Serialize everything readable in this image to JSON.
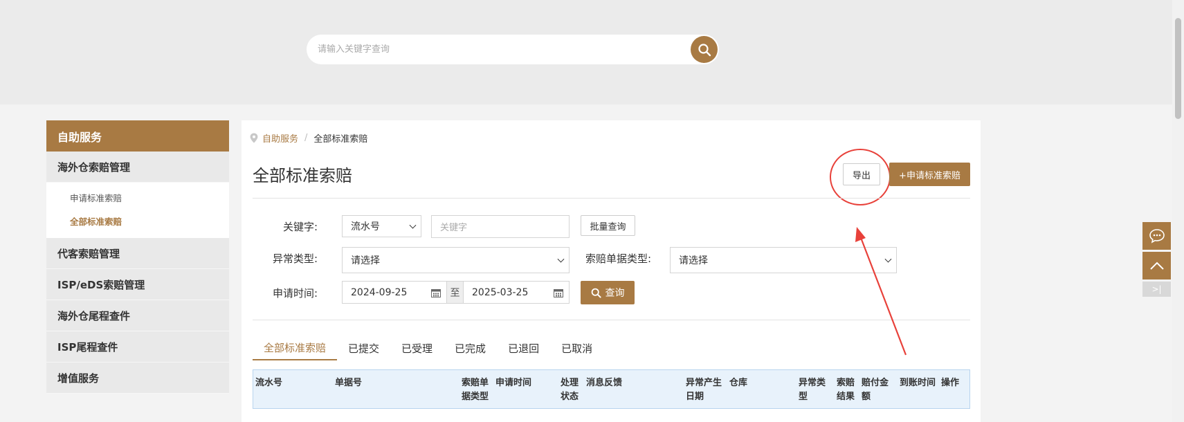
{
  "search": {
    "placeholder": "请输入关键字查询"
  },
  "sidebar": {
    "title": "自助服务",
    "groups": [
      {
        "label": "海外仓索赔管理",
        "items": [
          {
            "label": "申请标准索赔"
          },
          {
            "label": "全部标准索赔",
            "active": true
          }
        ]
      },
      {
        "label": "代客索赔管理"
      },
      {
        "label": "ISP/eDS索赔管理"
      },
      {
        "label": "海外仓尾程查件"
      },
      {
        "label": "ISP尾程查件"
      },
      {
        "label": "增值服务"
      }
    ]
  },
  "breadcrumb": {
    "parent": "自助服务",
    "sep": "/",
    "current": "全部标准索赔"
  },
  "page": {
    "title": "全部标准索赔",
    "export_label": "导出",
    "apply_label": "+申请标准索赔"
  },
  "filters": {
    "keyword_label": "关键字:",
    "keyword_type": "流水号",
    "keyword_placeholder": "关键字",
    "batch_label": "批量查询",
    "abnormal_label": "异常类型:",
    "abnormal_value": "请选择",
    "doc_type_label": "索赔单据类型:",
    "doc_type_value": "请选择",
    "date_label": "申请时间:",
    "date_from": "2024-09-25",
    "date_to": "2025-03-25",
    "to_label": "至",
    "query_label": "查询"
  },
  "tabs": [
    {
      "label": "全部标准索赔",
      "active": true
    },
    {
      "label": "已提交"
    },
    {
      "label": "已受理"
    },
    {
      "label": "已完成"
    },
    {
      "label": "已退回"
    },
    {
      "label": "已取消"
    }
  ],
  "table": {
    "headers": [
      "流水号",
      "单据号",
      "索赔单据类型",
      "申请时间",
      "处理状态",
      "消息反馈",
      "异常产生日期",
      "仓库",
      "异常类型",
      "索赔结果",
      "赔付金额",
      "到账时间",
      "操作"
    ]
  },
  "floating": {
    "collapse_label": ">|"
  },
  "colors": {
    "accent": "#a87a43",
    "annotation": "#e8413a"
  }
}
